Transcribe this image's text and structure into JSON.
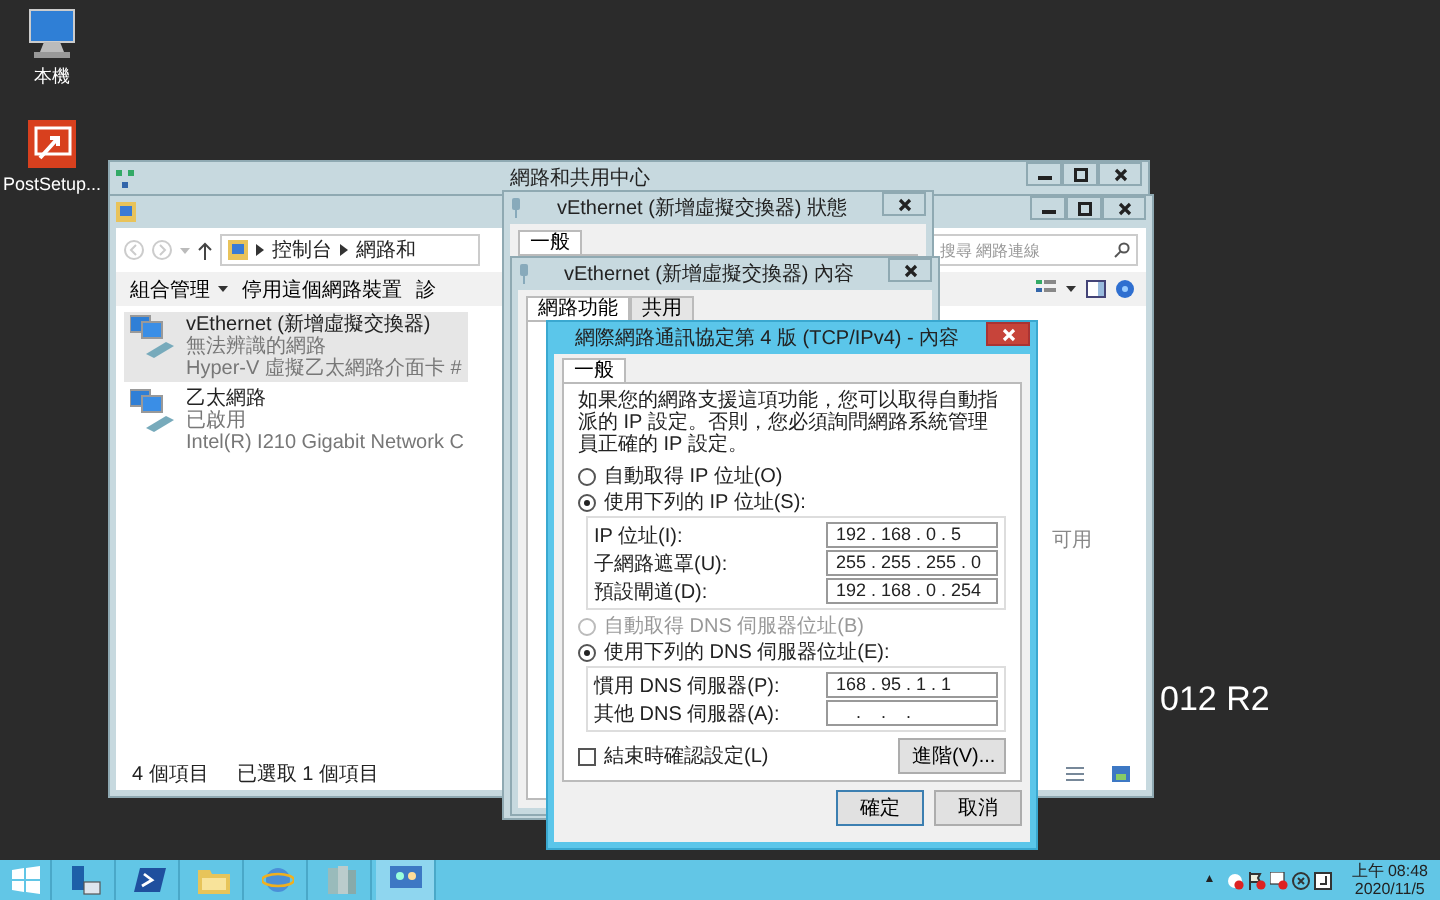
{
  "desktop_icons": [
    {
      "label": "本機",
      "kind": "computer"
    },
    {
      "label": "PostSetup...",
      "kind": "setup"
    }
  ],
  "desktop_text": "012 R2",
  "network_center_window": {
    "title": "網路和共用中心"
  },
  "connections_window": {
    "breadcrumb": [
      "控制台",
      "網路和"
    ],
    "search_placeholder": "搜尋 網路連線",
    "toolbar": [
      {
        "label": "組合管理",
        "dropdown": true
      },
      {
        "label": "停用這個網路裝置",
        "dropdown": false
      },
      {
        "label": "診",
        "dropdown": false
      }
    ],
    "connections": [
      {
        "name": "vEthernet (新增虛擬交換器)",
        "status": "無法辨識的網路",
        "adapter": "Hyper-V 虛擬乙太網路介面卡 #",
        "selected": true
      },
      {
        "name": "乙太網路",
        "status": "已啟用",
        "adapter": "Intel(R) I210 Gigabit Network C",
        "selected": false
      }
    ],
    "partial_text": "可用",
    "status_bar": [
      "4 個項目",
      "已選取 1 個項目"
    ]
  },
  "status_window": {
    "title": "vEthernet (新增虛擬交換器) 狀態",
    "tabs": [
      {
        "label": "一般",
        "selected": true
      }
    ]
  },
  "properties_window": {
    "title": "vEthernet (新增虛擬交換器) 內容",
    "tabs": [
      {
        "label": "網路功能",
        "selected": true
      },
      {
        "label": "共用",
        "selected": false
      }
    ]
  },
  "ipv4_dialog": {
    "title": "網際網路通訊協定第 4 版 (TCP/IPv4) - 內容",
    "tabs": [
      {
        "label": "一般",
        "selected": true
      }
    ],
    "intro": "如果您的網路支援這項功能，您可以取得自動指派的 IP 設定。否則，您必須詢問網路系統管理員正確的 IP 設定。",
    "sections": [
      {
        "options": [
          {
            "label": "自動取得 IP 位址(O)",
            "selected": false,
            "disabled": false
          },
          {
            "label": "使用下列的 IP 位址(S):",
            "selected": true,
            "disabled": false
          }
        ],
        "fields": [
          {
            "label": "IP 位址(I):",
            "value": "192 . 168 . 0 . 5"
          },
          {
            "label": "子網路遮罩(U):",
            "value": "255 . 255 . 255 . 0"
          },
          {
            "label": "預設閘道(D):",
            "value": "192 . 168 . 0 . 254"
          }
        ]
      },
      {
        "options": [
          {
            "label": "自動取得 DNS 伺服器位址(B)",
            "selected": false,
            "disabled": true
          },
          {
            "label": "使用下列的 DNS 伺服器位址(E):",
            "selected": true,
            "disabled": false
          }
        ],
        "fields": [
          {
            "label": "慣用 DNS 伺服器(P):",
            "value": "168 . 95 . 1 . 1"
          },
          {
            "label": "其他 DNS 伺服器(A):",
            "value": "    .    .    ."
          }
        ]
      }
    ],
    "validate_on_exit": {
      "label": "結束時確認設定(L)",
      "checked": false
    },
    "advanced_button": "進階(V)...",
    "buttons": [
      "確定",
      "取消"
    ]
  },
  "taskbar": {
    "apps": [
      {
        "kind": "start",
        "selected": false
      },
      {
        "kind": "server",
        "selected": false
      },
      {
        "kind": "terminal",
        "selected": false
      },
      {
        "kind": "folder",
        "selected": false
      },
      {
        "kind": "globe",
        "selected": false
      },
      {
        "kind": "towers",
        "selected": false
      },
      {
        "kind": "network",
        "selected": true
      }
    ],
    "tray_arrow": "▲",
    "time": "上午 08:48",
    "date": "2020/11/5"
  }
}
